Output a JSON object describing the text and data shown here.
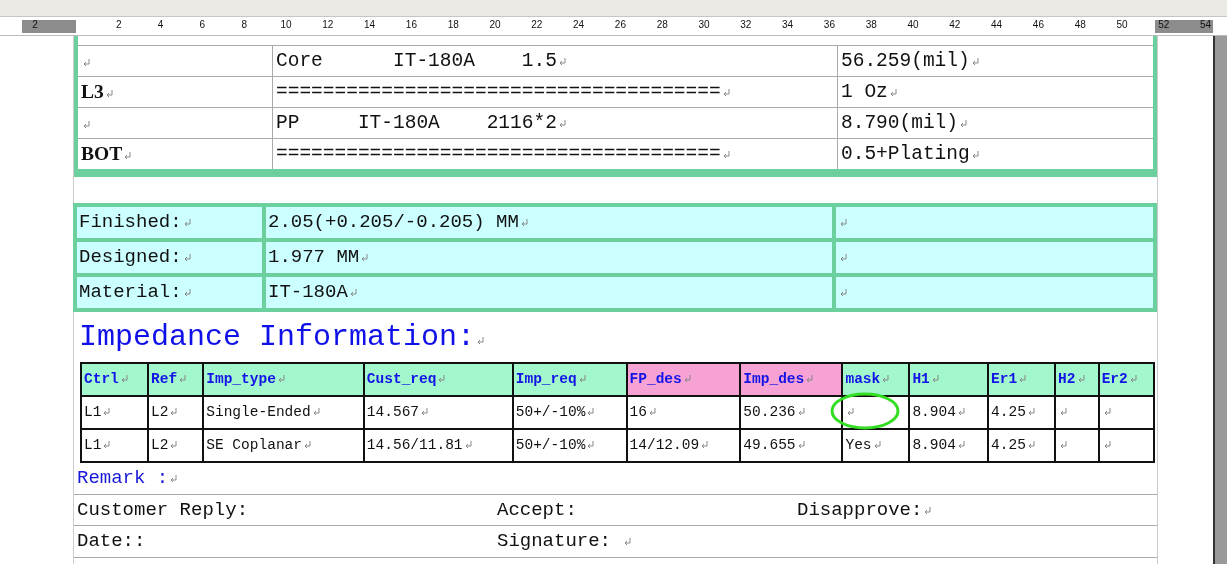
{
  "show_formatting_marks": true,
  "ruler": {
    "labels": [
      "2",
      "2",
      "4",
      "6",
      "8",
      "10",
      "12",
      "14",
      "16",
      "18",
      "20",
      "22",
      "24",
      "26",
      "28",
      "30",
      "32",
      "34",
      "36",
      "38",
      "40",
      "42",
      "44",
      "46",
      "48",
      "50",
      "52",
      "54"
    ]
  },
  "stackup": {
    "rows": [
      {
        "layer": "",
        "material": "Core      IT-180A    1.5",
        "thickness": "56.259(mil)"
      },
      {
        "layer": "L3",
        "material": "======================================",
        "thickness": "1 Oz"
      },
      {
        "layer": "",
        "material": "PP     IT-180A    2116*2",
        "thickness": "8.790(mil)"
      },
      {
        "layer": "BOT",
        "material": "======================================",
        "thickness": "0.5+Plating"
      }
    ]
  },
  "thickness": {
    "rows": [
      {
        "label": "Finished:",
        "value": "2.05(+0.205/-0.205) MM"
      },
      {
        "label": "Designed:",
        "value": "1.977 MM"
      },
      {
        "label": "Material:",
        "value": "IT-180A"
      }
    ]
  },
  "impedance": {
    "title": "Impedance Information:",
    "columns": [
      {
        "label": "Ctrl",
        "highlight": false
      },
      {
        "label": "Ref",
        "highlight": false
      },
      {
        "label": "Imp_type",
        "highlight": false
      },
      {
        "label": "Cust_req",
        "highlight": false
      },
      {
        "label": "Imp_req",
        "highlight": false
      },
      {
        "label": "FP_des",
        "highlight": true
      },
      {
        "label": "Imp_des",
        "highlight": true
      },
      {
        "label": "mask",
        "highlight": false
      },
      {
        "label": "H1",
        "highlight": false
      },
      {
        "label": "Er1",
        "highlight": false
      },
      {
        "label": "H2",
        "highlight": false
      },
      {
        "label": "Er2",
        "highlight": false
      }
    ],
    "rows": [
      {
        "cells": [
          "L1",
          "L2",
          "Single-Ended",
          "14.567",
          "50+/-10%",
          "16",
          "50.236",
          {
            "text": "",
            "circled": true
          },
          "8.904",
          "4.25",
          "",
          ""
        ]
      },
      {
        "cells": [
          "L1",
          "L2",
          "SE Coplanar",
          "14.56/11.81",
          "50+/-10%",
          "14/12.09",
          "49.655",
          "Yes",
          "8.904",
          "4.25",
          "",
          ""
        ]
      }
    ]
  },
  "remarks": [
    [
      {
        "text": "Remark :",
        "kind": "heading",
        "mark": true
      }
    ],
    [
      {
        "text": "Customer Reply:",
        "kind": "plain"
      },
      {
        "text": "Accept:",
        "kind": "plain"
      },
      {
        "text": "Disapprove:",
        "kind": "plain",
        "mark": true
      }
    ],
    [
      {
        "text": "Date::",
        "kind": "plain"
      },
      {
        "text": "Signature: ",
        "kind": "plain",
        "mark": true
      }
    ]
  ]
}
